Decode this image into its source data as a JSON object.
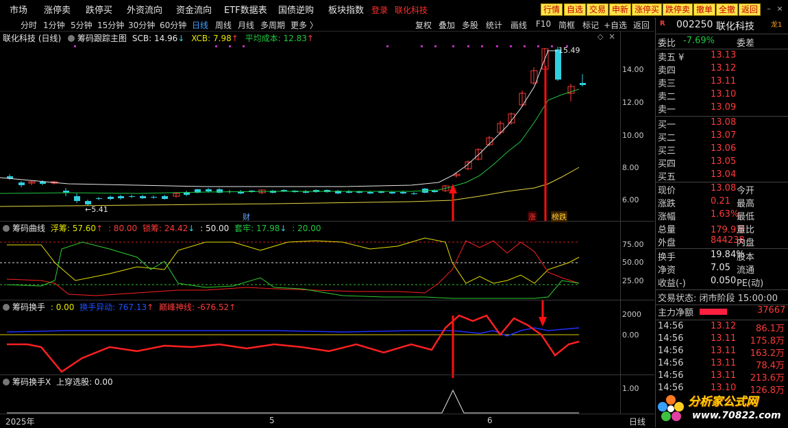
{
  "top_menu": {
    "items": [
      "市场",
      "涨停卖",
      "跌停买",
      "外资流向",
      "资金流向",
      "ETF数据表",
      "国债逆购",
      "板块指数"
    ],
    "login": "登录",
    "stock_name": "联化科技",
    "buttons": [
      "行情",
      "自选",
      "交易",
      "申新",
      "涨停买",
      "跌停卖",
      "撤单",
      "全撤",
      "返回"
    ]
  },
  "toolbar": {
    "periods": [
      "分时",
      "1分钟",
      "5分钟",
      "15分钟",
      "30分钟",
      "60分钟",
      "日线",
      "周线",
      "月线",
      "多周期",
      "更多 〉"
    ],
    "active_period": "日线",
    "right_items": [
      "复权",
      "叠加",
      "多股",
      "统计",
      "画线",
      "F10",
      "简框",
      "标记",
      "+自选",
      "返回"
    ]
  },
  "main_panel": {
    "title": "联化科技 (日线)",
    "indicator": "筹码跟踪主图",
    "scb": "SCB: 14.96",
    "scb_arrow": "↓",
    "xcb": "XCB: 7.98",
    "xcb_arrow": "↑",
    "avg_cost": "平均成本: 12.83",
    "avg_cost_arrow": "↑",
    "high_label": "15.49",
    "low_label": "←5.41",
    "tag_cai": "财",
    "tag_zhang": "涨",
    "tag_bangdie": "榜跌",
    "axis": [
      "14.00",
      "12.00",
      "10.00",
      "8.00",
      "6.00"
    ]
  },
  "curve_panel": {
    "indicator": "筹码曲线",
    "fuchou": "浮筹: 57.60",
    "fuchou_arrow": "↑",
    "v80": ": 80.00",
    "suochou": "锁筹: 24.42",
    "suochou_arrow": "↓",
    "v50": ": 50.00",
    "taolao": "套牢: 17.98",
    "taolao_arrow": "↓",
    "v20": ": 20.00",
    "axis": [
      "75.00",
      "50.00",
      "25.00"
    ]
  },
  "turnover_panel": {
    "indicator": "筹码换手",
    "value": ": 0.00",
    "yidong": "换手异动: 767.13",
    "yidong_arrow": "↑",
    "dianfeng": "巅峰神线: -676.52",
    "dianfeng_arrow": "↑",
    "axis": [
      "2000",
      "0.00"
    ]
  },
  "turnoverx_panel": {
    "indicator": "筹码换手X",
    "value": "上穿选股: 0.00",
    "axis": [
      "1.00"
    ]
  },
  "date_bar": {
    "labels": [
      "2025年",
      "5",
      "6"
    ],
    "period": "日线"
  },
  "quote": {
    "code_prefix": "R",
    "code": "002250",
    "name": "联化科技",
    "badge": "龙1",
    "weibi_label": "委比",
    "weibi_value": "-7.69%",
    "weicha_label": "委差",
    "sell": [
      {
        "label": "卖五 ¥",
        "price": "13.13"
      },
      {
        "label": "卖四",
        "price": "13.12"
      },
      {
        "label": "卖三",
        "price": "13.11"
      },
      {
        "label": "卖二",
        "price": "13.10"
      },
      {
        "label": "卖一",
        "price": "13.09"
      }
    ],
    "buy": [
      {
        "label": "买一",
        "price": "13.08"
      },
      {
        "label": "买二",
        "price": "13.07"
      },
      {
        "label": "买三",
        "price": "13.06"
      },
      {
        "label": "买四",
        "price": "13.05"
      },
      {
        "label": "买五",
        "price": "13.04"
      }
    ],
    "stats": [
      {
        "l1": "现价",
        "v1": "13.08",
        "l2": "今开"
      },
      {
        "l1": "涨跌",
        "v1": "0.21",
        "l2": "最高"
      },
      {
        "l1": "涨幅",
        "v1": "1.63%",
        "l2": "最低"
      },
      {
        "l1": "总量",
        "v1": "179.9万",
        "l2": "量比"
      },
      {
        "l1": "外盘",
        "v1": "844238",
        "l2": "内盘"
      }
    ],
    "stats2": [
      {
        "l1": "换手",
        "v1": "19.84%",
        "l2": "股本"
      },
      {
        "l1": "净资",
        "v1": "7.05",
        "l2": "流通"
      },
      {
        "l1": "收益(-)",
        "v1": "0.050",
        "l2": "PE(动)"
      }
    ],
    "trade_status": "交易状态: 闭市阶段 15:00:00",
    "main_flow_label": "主力净额",
    "main_flow_value": "37667",
    "ticks": [
      {
        "time": "14:56",
        "price": "13.12",
        "vol": "86.1万"
      },
      {
        "time": "14:56",
        "price": "13.11",
        "vol": "175.8万"
      },
      {
        "time": "14:56",
        "price": "13.11",
        "vol": "163.2万"
      },
      {
        "time": "14:56",
        "price": "13.11",
        "vol": "78.4万"
      },
      {
        "time": "14:56",
        "price": "13.11",
        "vol": "213.6万"
      },
      {
        "time": "14:56",
        "price": "13.10",
        "vol": "126.8万"
      }
    ]
  },
  "watermark": {
    "name": "分析家公式网",
    "url": "www.70822.com"
  },
  "colors": {
    "up": "#ff3a3a",
    "down": "#30d0e0",
    "ma_white": "#e8e8e8",
    "ma_green": "#20c840",
    "ma_yellow": "#e8d840",
    "arrow": "#ff1010"
  }
}
